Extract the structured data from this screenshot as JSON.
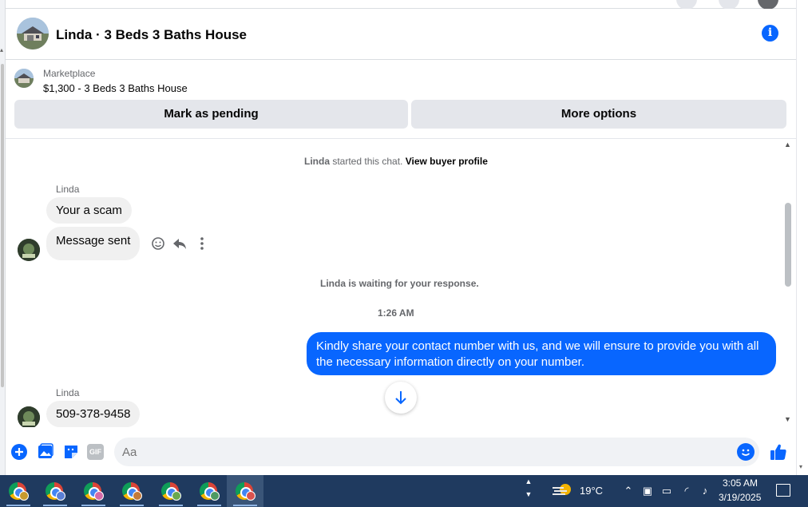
{
  "header": {
    "title": "Linda · 3 Beds 3 Baths House"
  },
  "marketplace": {
    "label": "Marketplace",
    "item": "$1,300 - 3 Beds 3 Baths House",
    "mark_pending_label": "Mark as pending",
    "more_options_label": "More options"
  },
  "chat": {
    "started_name": "Linda",
    "started_text": " started this chat. ",
    "view_profile_label": "View buyer profile",
    "messages": [
      {
        "sender": "Linda",
        "text": "Your a scam"
      },
      {
        "text": "Message sent"
      }
    ],
    "waiting_text": "Linda is waiting for your response.",
    "timestamp": "1:26 AM",
    "outgoing": "Kindly share your contact number with us, and we will ensure to provide you with all the necessary information directly on your number.",
    "reply_sender": "Linda",
    "reply_text": "509-378-9458"
  },
  "composer": {
    "placeholder": "Aa",
    "gif_label": "GIF"
  },
  "taskbar": {
    "temperature": "19°C",
    "time": "3:05 AM",
    "date": "3/19/2025",
    "colors": {
      "background": "#1f3a5f",
      "messenger_blue": "#0866ff"
    }
  }
}
